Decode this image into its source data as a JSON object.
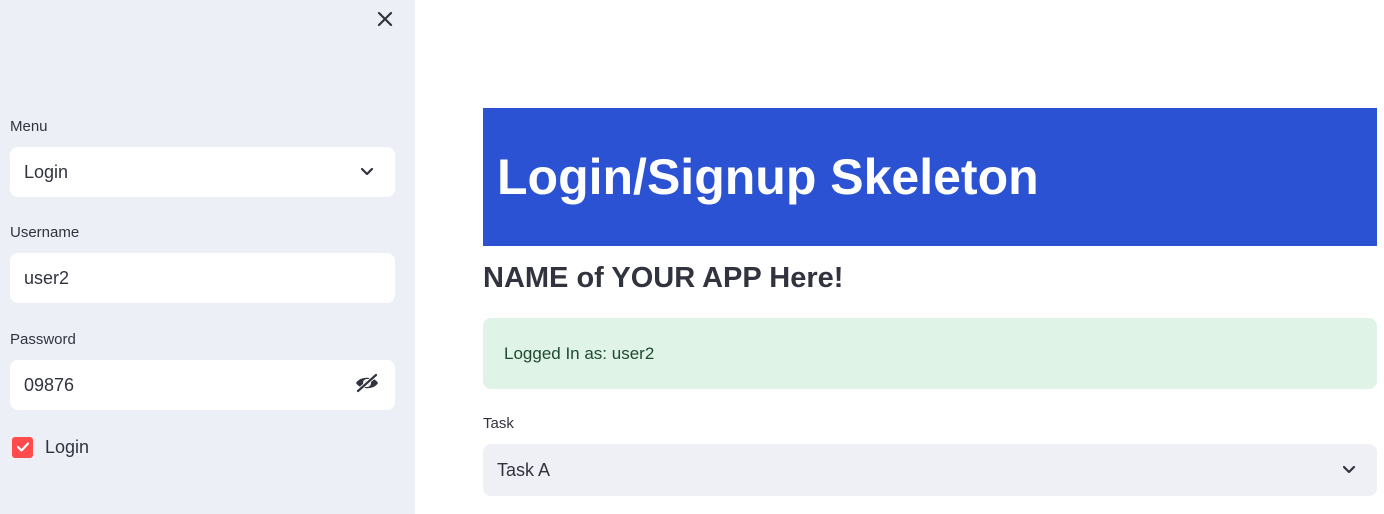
{
  "sidebar": {
    "menu": {
      "label": "Menu",
      "selected": "Login",
      "icon": "chevron-down-icon"
    },
    "username": {
      "label": "Username",
      "value": "user2"
    },
    "password": {
      "label": "Password",
      "value": "09876",
      "icon": "eye-off-icon"
    },
    "login_checkbox": {
      "label": "Login",
      "checked": true
    },
    "close_icon": "close-icon"
  },
  "main": {
    "banner_title": "Login/Signup Skeleton",
    "subtitle": "NAME of YOUR APP Here!",
    "success_message": "Logged In as: user2",
    "task": {
      "label": "Task",
      "selected": "Task A",
      "icon": "chevron-down-icon"
    }
  },
  "colors": {
    "sidebar_bg": "#eceff5",
    "banner_bg": "#2b52d2",
    "success_bg": "#dff3e7",
    "checkbox_accent": "#ff4b4b"
  }
}
